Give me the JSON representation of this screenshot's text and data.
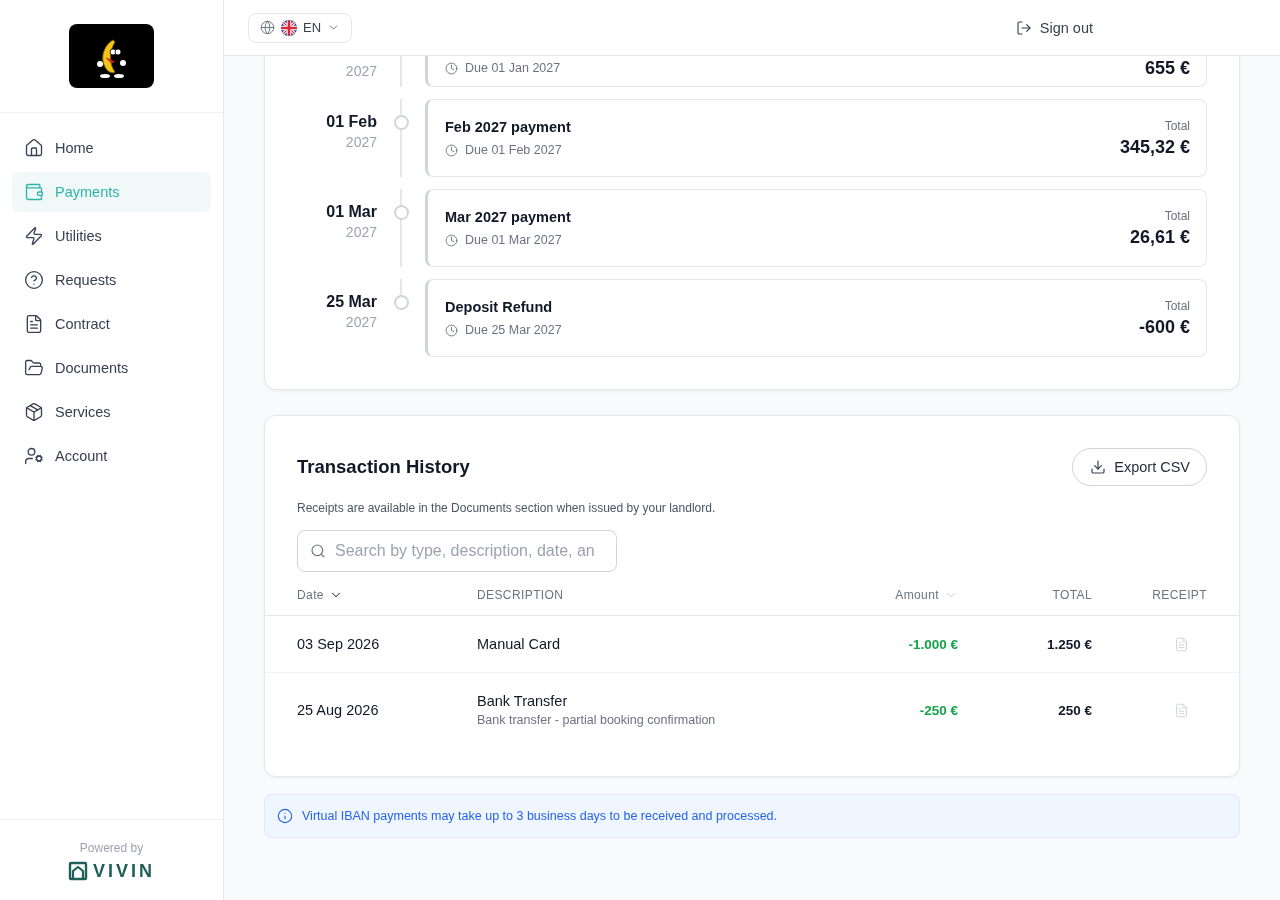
{
  "sidebar": {
    "nav": [
      {
        "label": "Home",
        "selected": false
      },
      {
        "label": "Payments",
        "selected": true
      },
      {
        "label": "Utilities",
        "selected": false
      },
      {
        "label": "Requests",
        "selected": false
      },
      {
        "label": "Contract",
        "selected": false
      },
      {
        "label": "Documents",
        "selected": false
      },
      {
        "label": "Services",
        "selected": false
      },
      {
        "label": "Account",
        "selected": false
      }
    ],
    "footer": {
      "powered_by": "Powered by",
      "brand": "VIVIN"
    }
  },
  "header": {
    "language": {
      "code": "EN"
    },
    "sign_out": "Sign out"
  },
  "schedule": {
    "items": [
      {
        "year": "2027",
        "due": "Due 01 Jan 2027",
        "total": "655 €"
      },
      {
        "day": "01 Feb",
        "year": "2027",
        "title": "Feb 2027 payment",
        "due": "Due 01 Feb 2027",
        "total_label": "Total",
        "total": "345,32 €"
      },
      {
        "day": "01 Mar",
        "year": "2027",
        "title": "Mar 2027 payment",
        "due": "Due 01 Mar 2027",
        "total_label": "Total",
        "total": "26,61 €"
      },
      {
        "day": "25 Mar",
        "year": "2027",
        "title": "Deposit Refund",
        "due": "Due 25 Mar 2027",
        "total_label": "Total",
        "total": "-600 €"
      }
    ]
  },
  "transactions": {
    "title": "Transaction History",
    "export_button": "Export CSV",
    "note": "Receipts are available in the Documents section when issued by your landlord.",
    "search": {
      "placeholder": "Search by type, description, date, an"
    },
    "columns": [
      {
        "label": "Date",
        "sorted": true
      },
      {
        "label": "DESCRIPTION"
      },
      {
        "label": "Amount",
        "sorted": false
      },
      {
        "label": "TOTAL"
      },
      {
        "label": "RECEIPT"
      }
    ],
    "rows": [
      {
        "date": "03 Sep 2026",
        "description": "Manual Card",
        "amount": "-1.000 €",
        "total": "1.250 €",
        "receipt_available": false
      },
      {
        "date": "25 Aug 2026",
        "description": "Bank Transfer",
        "detail": "Bank transfer - partial booking confirmation",
        "amount": "-250 €",
        "total": "250 €",
        "receipt_available": false
      }
    ]
  },
  "info_banner": {
    "text": "Virtual IBAN payments may take up to 3 business days to be received and processed."
  }
}
